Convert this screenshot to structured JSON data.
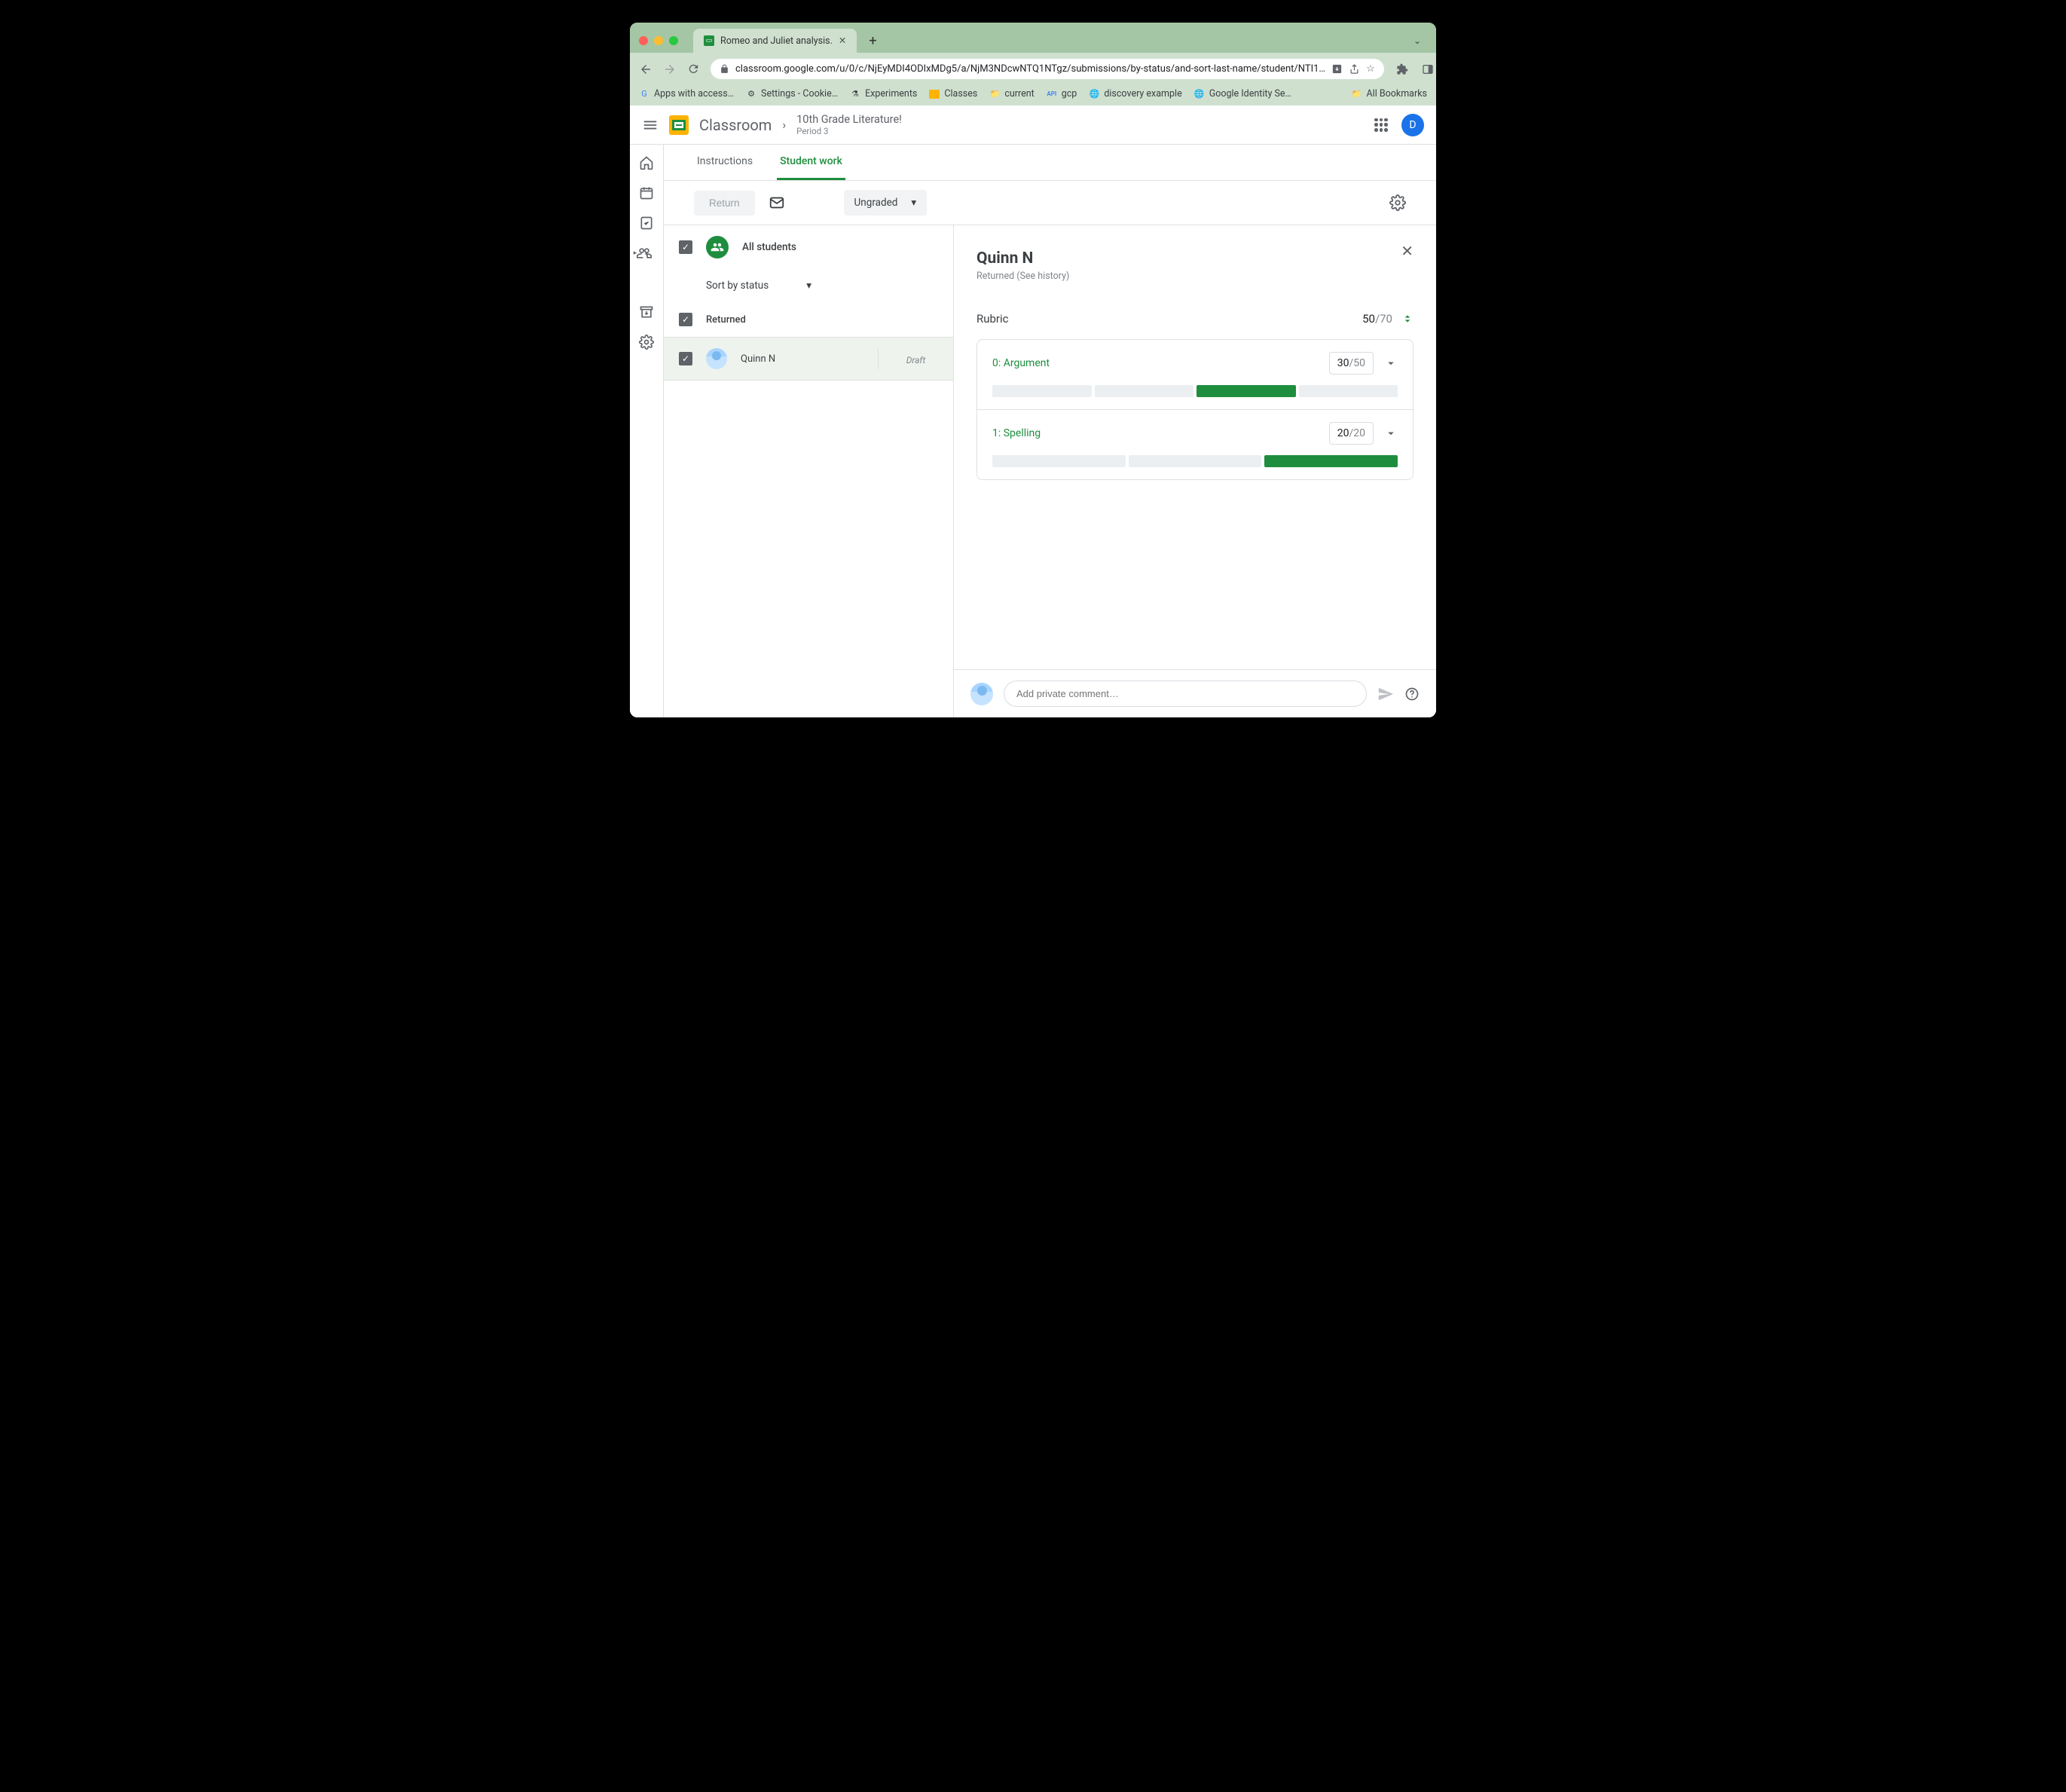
{
  "browser": {
    "tab_title": "Romeo and Juliet analysis.",
    "url": "classroom.google.com/u/0/c/NjEyMDI4ODIxMDg5/a/NjM3NDcwNTQ1NTgz/submissions/by-status/and-sort-last-name/student/NTI1…",
    "bookmarks": {
      "apps": "Apps with access…",
      "settings": "Settings - Cookie…",
      "experiments": "Experiments",
      "classes": "Classes",
      "current": "current",
      "gcp": "gcp",
      "discovery": "discovery example",
      "identity": "Google Identity Se…",
      "all": "All Bookmarks"
    },
    "avatar_initial": "D"
  },
  "header": {
    "app_name": "Classroom",
    "breadcrumb_title": "10th Grade Literature!",
    "breadcrumb_sub": "Period 3",
    "avatar_initial": "D"
  },
  "tabs": {
    "instructions": "Instructions",
    "student_work": "Student work"
  },
  "toolbar": {
    "return_label": "Return",
    "filter_label": "Ungraded"
  },
  "left_pane": {
    "all_students": "All students",
    "sort_label": "Sort by status",
    "section_returned": "Returned",
    "student_name": "Quinn N",
    "student_status": "Draft"
  },
  "right_pane": {
    "student_name": "Quinn N",
    "status_line": "Returned (See history)",
    "rubric_label": "Rubric",
    "rubric_score": "50",
    "rubric_total": "/70",
    "criteria": {
      "c0": {
        "name": "0: Argument",
        "score": "30",
        "total": "/50"
      },
      "c1": {
        "name": "1: Spelling",
        "score": "20",
        "total": "/20"
      }
    },
    "comment_placeholder": "Add private comment…"
  }
}
